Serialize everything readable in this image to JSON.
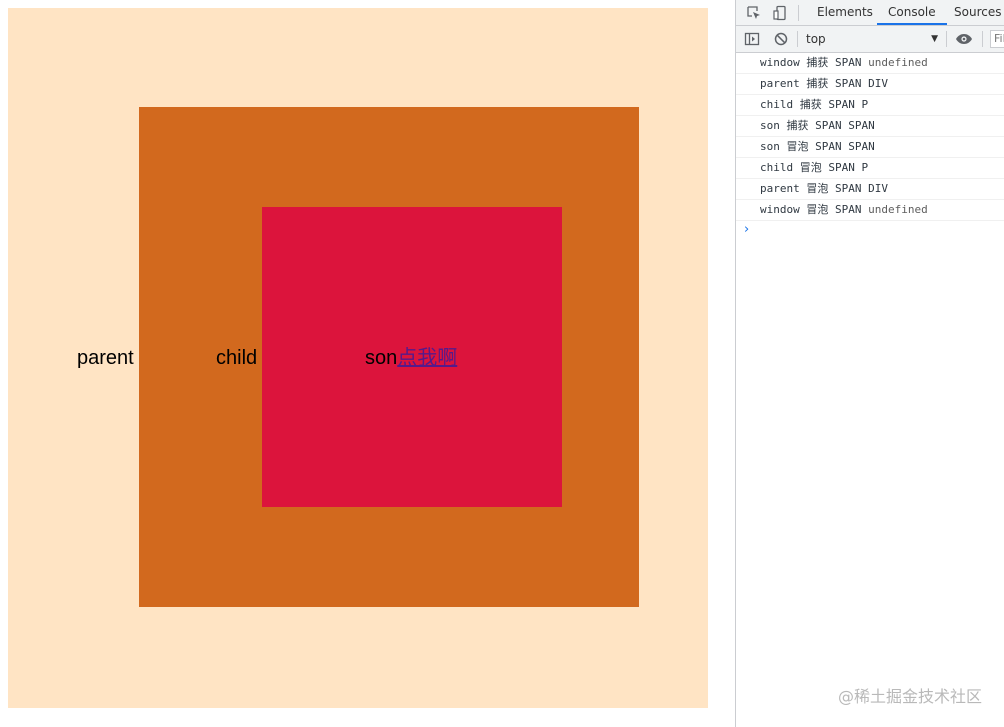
{
  "page": {
    "labels": {
      "parent": "parent",
      "child": "child",
      "son": "son",
      "link": "点我啊"
    },
    "colors": {
      "parent": "#ffe4c4",
      "child": "#d2691e",
      "son": "#dc143c",
      "link": "#551a8b"
    }
  },
  "devtools": {
    "tabs": [
      {
        "label": "Elements",
        "active": false
      },
      {
        "label": "Console",
        "active": true
      },
      {
        "label": "Sources",
        "active": false
      }
    ],
    "icons": [
      "inspect-element-icon",
      "device-toolbar-icon",
      "sidebar-toggle-icon",
      "clear-console-icon",
      "eye-icon"
    ],
    "context": "top",
    "filter_placeholder": "Filter",
    "filter_visible": "Fil",
    "accent": "#1a73e8",
    "logs": [
      {
        "a": "window 捕获 SPAN",
        "b": "undefined"
      },
      {
        "a": "parent 捕获 SPAN",
        "b": "DIV"
      },
      {
        "a": "child 捕获 SPAN",
        "b": "P"
      },
      {
        "a": "son 捕获 SPAN",
        "b": "SPAN"
      },
      {
        "a": "son 冒泡 SPAN",
        "b": "SPAN"
      },
      {
        "a": "child 冒泡 SPAN",
        "b": "P"
      },
      {
        "a": "parent 冒泡 SPAN",
        "b": "DIV"
      },
      {
        "a": "window 冒泡 SPAN",
        "b": "undefined"
      }
    ]
  },
  "watermark": "@稀土掘金技术社区"
}
